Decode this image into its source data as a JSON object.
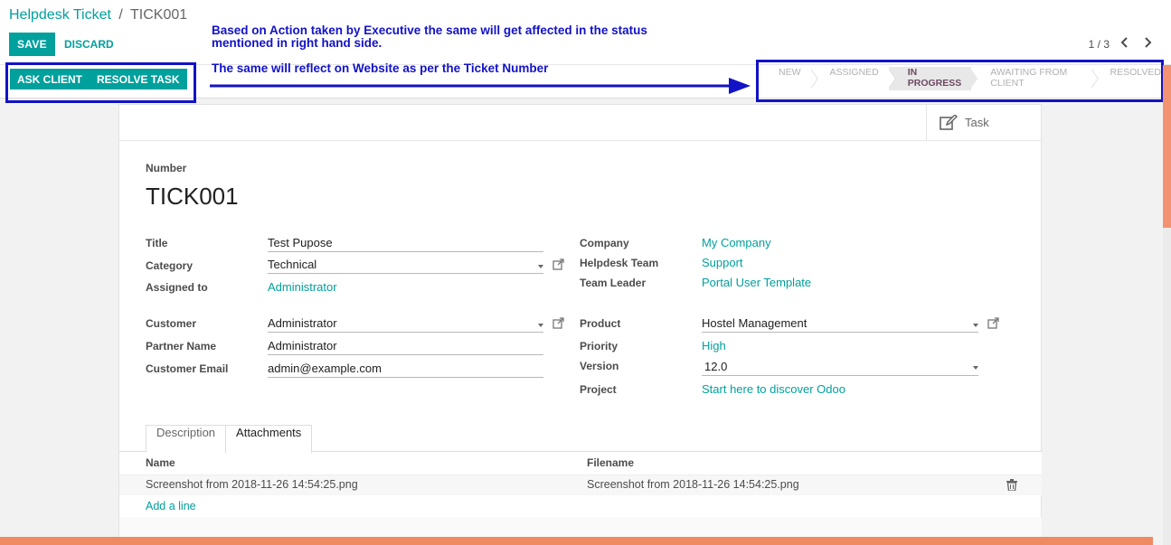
{
  "breadcrumb": {
    "parent": "Helpdesk Ticket",
    "separator": "/",
    "current": "TICK001"
  },
  "toolbar": {
    "save_label": "SAVE",
    "discard_label": "DISCARD"
  },
  "pager": {
    "value": "1 / 3"
  },
  "annotations": {
    "note_1": "Based on Action taken by Executive the same will get affected in the status mentioned in right hand side.",
    "note_2": "The same will reflect on Website as per the Ticket Number",
    "color": "#1212c7"
  },
  "status_buttons": {
    "ask_client": "ASK CLIENT",
    "resolve_task": "RESOLVE TASK"
  },
  "stages": [
    {
      "label": "NEW",
      "active": false
    },
    {
      "label": "ASSIGNED",
      "active": false
    },
    {
      "label": "IN PROGRESS",
      "active": true
    },
    {
      "label": "AWAITING FROM CLIENT",
      "active": false
    },
    {
      "label": "RESOLVED",
      "active": false
    }
  ],
  "smart_button": {
    "label": "Task",
    "icon": "edit-icon"
  },
  "form": {
    "number_label": "Number",
    "number": "TICK001",
    "title_label": "Title",
    "title": "Test Pupose",
    "category_label": "Category",
    "category": "Technical",
    "assigned_label": "Assigned to",
    "assigned": "Administrator",
    "customer_label": "Customer",
    "customer": "Administrator",
    "partner_label": "Partner Name",
    "partner": "Administrator",
    "email_label": "Customer Email",
    "email": "admin@example.com",
    "company_label": "Company",
    "company": "My Company",
    "team_label": "Helpdesk Team",
    "team": "Support",
    "leader_label": "Team Leader",
    "leader": "Portal User Template",
    "product_label": "Product",
    "product": "Hostel Management",
    "priority_label": "Priority",
    "priority": "High",
    "version_label": "Version",
    "version": "12.0",
    "project_label": "Project",
    "project": "Start here to discover Odoo"
  },
  "tabs": [
    {
      "label": "Description",
      "active": false
    },
    {
      "label": "Attachments",
      "active": true
    }
  ],
  "attachments": {
    "columns": [
      "Name",
      "Filename"
    ],
    "rows": [
      [
        "Screenshot from 2018-11-26 14:54:25.png",
        "Screenshot from 2018-11-26 14:54:25.png"
      ]
    ],
    "add_line": "Add a line"
  },
  "colors": {
    "brand": "#00a09d",
    "accent": "#ef8a62"
  }
}
